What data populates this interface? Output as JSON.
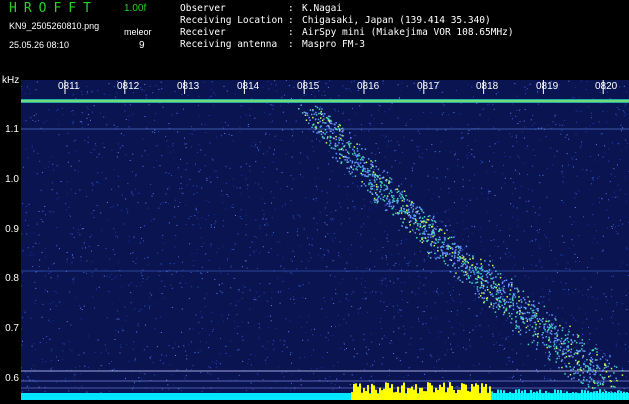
{
  "header": {
    "app_title": "HROFFT",
    "version": "1.00f",
    "filename": "KN9_2505260810.png",
    "meleor_label": "meleor",
    "meleor_count": "9",
    "timestamp": "25.05.26 08:10"
  },
  "meta": [
    {
      "key": "Observer",
      "value": "K.Nagai"
    },
    {
      "key": "Receiving Location",
      "value": "Chigasaki, Japan (139.414 35.340)"
    },
    {
      "key": "Receiver",
      "value": "AirSpy mini (Miakejima VOR 108.65MHz)"
    },
    {
      "key": "Receiving antenna",
      "value": "Maspro FM-3"
    }
  ],
  "axis": {
    "y_unit": "kHz",
    "y_ticks": [
      "1.1",
      "1.0",
      "0.9",
      "0.8",
      "0.7",
      "0.6"
    ],
    "x_ticks": [
      "0811",
      "0812",
      "0813",
      "0814",
      "0815",
      "0816",
      "0817",
      "0818",
      "0819",
      "0820"
    ]
  },
  "colors": {
    "background": "#000000",
    "spectrum_bg": "#0a1450",
    "title_green": "#28d228",
    "signal_yellow": "#ffff00",
    "signal_cyan": "#00ffff"
  }
}
